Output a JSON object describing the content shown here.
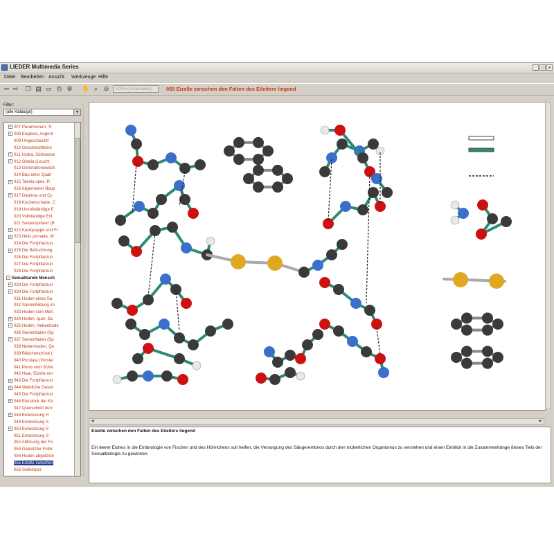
{
  "window": {
    "title": "LIEDER Multimedia Series"
  },
  "menu": [
    "Datei",
    "Bearbeiten",
    "Ansicht",
    "Werkzeuge",
    "Hilfe"
  ],
  "toolbar": {
    "zoom": "100% (Vorauswahl)",
    "doc_title": "055 Eizelle zwischen den Falten des Eileiters liegend"
  },
  "filter": {
    "label": "Filter:",
    "value": "(alle Kataloge)"
  },
  "tree": {
    "items": [
      {
        "text": "007 Paramecium, Tr",
        "exp": "+"
      },
      {
        "text": "008 Euglena, Augent",
        "exp": "+"
      },
      {
        "text": "009 Ungeschlechtl",
        "exp": ""
      },
      {
        "text": "010 Geschlechtliche",
        "exp": ""
      },
      {
        "text": "011 Hydra, Süßwasse",
        "exp": "+"
      },
      {
        "text": "012 Obelia (Leucht",
        "exp": "+"
      },
      {
        "text": "013 Generationswech",
        "exp": ""
      },
      {
        "text": "014 Bau einer Quall",
        "exp": ""
      },
      {
        "text": "015 Taenia spec. R",
        "exp": "+"
      },
      {
        "text": "016 Allgemeiner Baup",
        "exp": ""
      },
      {
        "text": "017 Daphnia und Cy",
        "exp": "+"
      },
      {
        "text": "018 Kuchenschabe, C",
        "exp": ""
      },
      {
        "text": "019 Unvollständige E",
        "exp": ""
      },
      {
        "text": "020 Vollständige Ent",
        "exp": ""
      },
      {
        "text": "021 Seidenspinner (B",
        "exp": ""
      },
      {
        "text": "022 Kaulquappe und Fr",
        "exp": "+"
      },
      {
        "text": "023 Helix pomatia, W",
        "exp": "+"
      },
      {
        "text": "024 Die Fortpflanzun",
        "exp": ""
      },
      {
        "text": "025 Die Befruchtung",
        "exp": "+"
      },
      {
        "text": "026 Die Fortpflanzun",
        "exp": ""
      },
      {
        "text": "027 Die Fortpflanzun",
        "exp": ""
      },
      {
        "text": "028 Die Fortpflanzun",
        "exp": ""
      },
      {
        "text": "Sexualkunde Mensch",
        "exp": "-",
        "section": true
      },
      {
        "text": "029 Die Fortpflanzun",
        "exp": "+"
      },
      {
        "text": "030 Die Fortpflanzun",
        "exp": "+"
      },
      {
        "text": "031 Hoden eines Sa",
        "exp": ""
      },
      {
        "text": "032 Samenbildung im",
        "exp": ""
      },
      {
        "text": "033 Hoden vom Men",
        "exp": ""
      },
      {
        "text": "034 Hoden, quer. Sa",
        "exp": "+"
      },
      {
        "text": "035 Hoden, Nebenhode",
        "exp": "+"
      },
      {
        "text": "036 Samenfaden (Sp",
        "exp": ""
      },
      {
        "text": "037 Samenfaden (Sp",
        "exp": "+"
      },
      {
        "text": "038 Nebenhoden, Qu",
        "exp": ""
      },
      {
        "text": "039 Bläschendrüse (",
        "exp": ""
      },
      {
        "text": "040 Prostata (Vorstel",
        "exp": ""
      },
      {
        "text": "041 Penis vom Schw",
        "exp": ""
      },
      {
        "text": "042 Haar, Eizelle um",
        "exp": ""
      },
      {
        "text": "043 Die Fortpflanzun",
        "exp": "+"
      },
      {
        "text": "044 Weibliche Gesch",
        "exp": "+"
      },
      {
        "text": "045 Die Fortpflanzun",
        "exp": ""
      },
      {
        "text": "046 Eierstock der Ka",
        "exp": "+"
      },
      {
        "text": "047 Querschnitt durc",
        "exp": ""
      },
      {
        "text": "048 Entwicklung H",
        "exp": "+"
      },
      {
        "text": "049 Entwicklung S",
        "exp": ""
      },
      {
        "text": "050 Entwicklung S",
        "exp": "+"
      },
      {
        "text": "051 Entwicklung S",
        "exp": ""
      },
      {
        "text": "052 Ablösung der Fo",
        "exp": ""
      },
      {
        "text": "053 Geplatzter Follik",
        "exp": ""
      },
      {
        "text": "054 Hoden abgelöste",
        "exp": ""
      },
      {
        "text": "055 Eizelle zwischen",
        "exp": "",
        "selected": true
      },
      {
        "text": "056 Seitkörper",
        "exp": ""
      }
    ]
  },
  "description": {
    "title": "Eizelle zwischen den Falten des Eileiters liegend",
    "text": "Ein leerer Eidreis in die Embriologie von Fischen und des Hühnchens soll helfen, die Versorgung des Säugerembrios durch den mütterlichen Organismus zu verstehen und einen Einblick in die Zusammenhänge dieses Teils der Sexualbiologie zu gewinnen."
  },
  "colors": {
    "carbon": "#3a3a3a",
    "nitrogen": "#3b6fcc",
    "oxygen": "#cc1111",
    "hydrogen": "#e8e8e8",
    "sulfur": "#e0a820",
    "bond": "#2e8a78",
    "doc_title": "#cc3311"
  }
}
